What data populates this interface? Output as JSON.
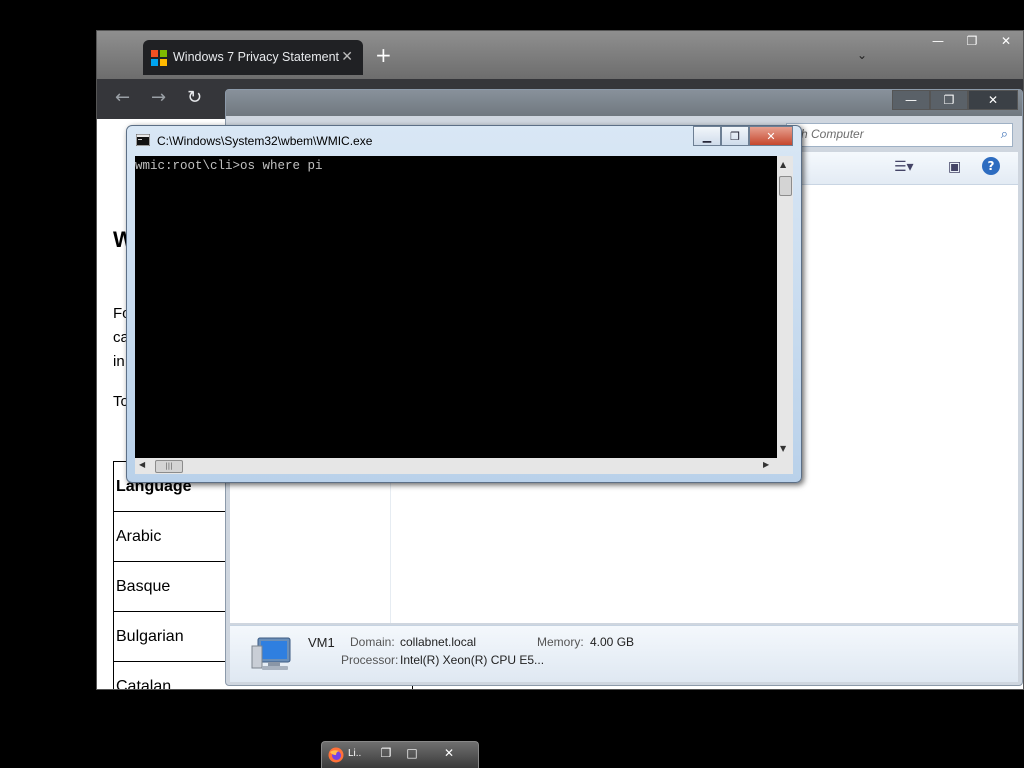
{
  "browser": {
    "tab_title": "Windows 7 Privacy Statement",
    "tab_close": "✕",
    "new_tab": "+",
    "tab_dropdown": "⌄",
    "win_min": "—",
    "win_max": "❐",
    "win_close": "✕",
    "back": "←",
    "forward": "→",
    "reload": "↻",
    "page": {
      "heading": "W",
      "para1_lines": [
        "Fo",
        "ca",
        "in"
      ],
      "para2": "To",
      "table_header": "Language",
      "languages": [
        "Arabic",
        "Basque",
        "Bulgarian",
        "Catalan"
      ]
    }
  },
  "explorer": {
    "search_placeholder": "rch Computer",
    "search_icon": "⌕",
    "win_min": "—",
    "win_max": "❐",
    "win_close": "✕",
    "help": "?",
    "details": {
      "name": "VM1",
      "domain_label": "Domain:",
      "domain_value": "collabnet.local",
      "memory_label": "Memory:",
      "memory_value": "4.00 GB",
      "processor_label": "Processor:",
      "processor_value": "Intel(R) Xeon(R) CPU E5..."
    }
  },
  "console": {
    "title": "C:\\Windows\\System32\\wbem\\WMIC.exe",
    "min": "▁",
    "max": "❐",
    "close": "✕",
    "prompt_line": "wmic:root\\cli>os where pi",
    "hscroll_thumb": "|||",
    "arrow_up": "▲",
    "arrow_down": "▼",
    "arrow_left": "◀",
    "arrow_right": "▶"
  },
  "minimized": {
    "title": "Li..",
    "restore": "❐",
    "max": "□",
    "close": "✕"
  }
}
